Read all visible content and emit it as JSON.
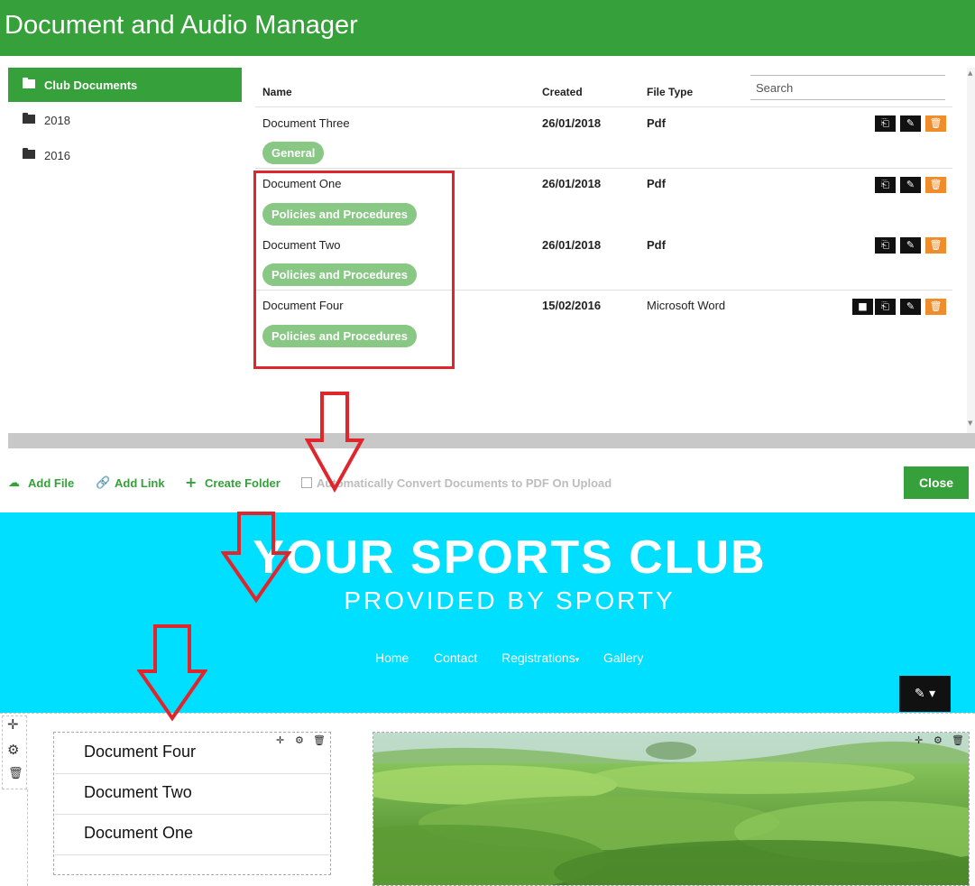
{
  "header": {
    "title": "Document and Audio Manager"
  },
  "sidebar": {
    "items": [
      {
        "label": "Club Documents",
        "active": true
      },
      {
        "label": "2018",
        "active": false
      },
      {
        "label": "2016",
        "active": false
      }
    ]
  },
  "table": {
    "columns": {
      "name": "Name",
      "created": "Created",
      "file_type": "File Type"
    },
    "search_placeholder": "Search",
    "rows": [
      {
        "name": "Document Three",
        "created": "26/01/2018",
        "type": "Pdf",
        "tag": "General"
      },
      {
        "name": "Document One",
        "created": "26/01/2018",
        "type": "Pdf",
        "tag": "Policies and Procedures"
      },
      {
        "name": "Document Two",
        "created": "26/01/2018",
        "type": "Pdf",
        "tag": "Policies and Procedures"
      },
      {
        "name": "Document Four",
        "created": "15/02/2016",
        "type": "Microsoft Word",
        "tag": "Policies and Procedures"
      }
    ],
    "row_actions": [
      "move-icon",
      "edit-icon",
      "delete-icon"
    ],
    "extra_action_row_3": "file-icon"
  },
  "footer": {
    "add_file": "Add File",
    "add_link": "Add Link",
    "create_folder": "Create Folder",
    "auto_convert": "Automatically Convert Documents to PDF On Upload",
    "close": "Close"
  },
  "site": {
    "brand": "YOUR SPORTS CLUB",
    "tagline": "PROVIDED BY SPORTY",
    "nav": [
      "Home",
      "Contact",
      "Registrations",
      "Gallery"
    ],
    "document_widget": [
      "Document Four",
      "Document Two",
      "Document One"
    ]
  },
  "colors": {
    "primary_green": "#36a03a",
    "tag_green": "#88c784",
    "delete_orange": "#f08c2a",
    "site_cyan": "#00dfff",
    "annotation_red": "#e0262d"
  }
}
